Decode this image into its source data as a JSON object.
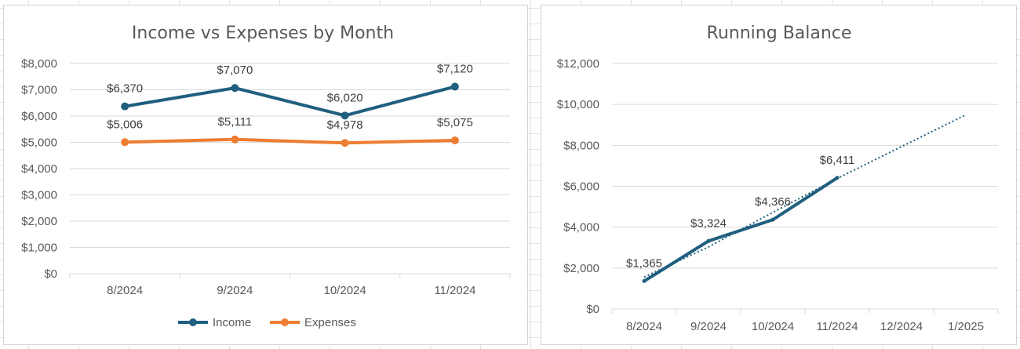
{
  "colors": {
    "income": "#1f5f7f",
    "expenses": "#ed7d31",
    "balance": "#1f5f7f"
  },
  "chart_data": [
    {
      "type": "line",
      "title": "Income vs Expenses by Month",
      "categories": [
        "8/2024",
        "9/2024",
        "10/2024",
        "11/2024"
      ],
      "series": [
        {
          "name": "Income",
          "values": [
            6370,
            7070,
            6020,
            7120
          ],
          "labels": [
            "$6,370",
            "$7,070",
            "$6,020",
            "$7,120"
          ]
        },
        {
          "name": "Expenses",
          "values": [
            5006,
            5111,
            4978,
            5075
          ],
          "labels": [
            "$5,006",
            "$5,111",
            "$4,978",
            "$5,075"
          ]
        }
      ],
      "ylim": [
        0,
        8000
      ],
      "yticks": [
        "$0",
        "$1,000",
        "$2,000",
        "$3,000",
        "$4,000",
        "$5,000",
        "$6,000",
        "$7,000",
        "$8,000"
      ],
      "grid": true,
      "legend": "bottom"
    },
    {
      "type": "line",
      "title": "Running Balance",
      "categories": [
        "8/2024",
        "9/2024",
        "10/2024",
        "11/2024",
        "12/2024",
        "1/2025"
      ],
      "series": [
        {
          "values": [
            1365,
            3324,
            4366,
            6411
          ],
          "labels": [
            "$1,365",
            "$3,324",
            "$4,366",
            "$6,411"
          ]
        }
      ],
      "trendline": {
        "style": "dotted",
        "values": [
          1560,
          3035,
          4720,
          6380,
          7940,
          9490
        ]
      },
      "ylim": [
        0,
        12000
      ],
      "yticks": [
        "$0",
        "$2,000",
        "$4,000",
        "$6,000",
        "$8,000",
        "$10,000",
        "$12,000"
      ],
      "grid": true,
      "legend": "none"
    }
  ]
}
